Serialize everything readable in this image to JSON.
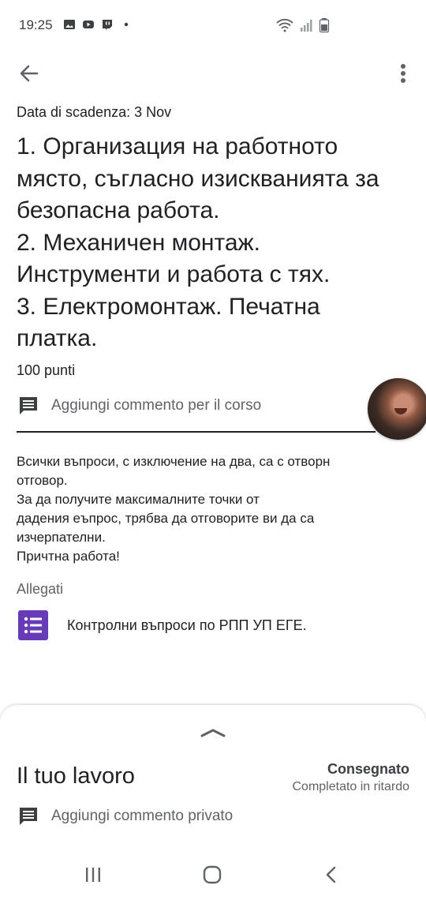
{
  "status_bar": {
    "time": "19:25",
    "icons_left": [
      "image-icon",
      "youtube-icon",
      "twitch-icon",
      "dot-icon"
    ],
    "icons_right": [
      "wifi-icon",
      "signal-icon",
      "battery-icon"
    ]
  },
  "toolbar": {
    "back_icon": "arrow-back-icon",
    "more_icon": "more-vert-icon"
  },
  "assignment": {
    "due_date": "Data di scadenza: 3 Nov",
    "title_lines": [
      "1. Организация на работното",
      "място, съгласно изискванията за",
      "безопасна работа.",
      "2. Механичен монтаж.",
      "Инструменти и работа с тях.",
      "3. Електромонтаж. Печатна",
      "платка."
    ],
    "points": "100 punti",
    "class_comment_placeholder": "Aggiungi commento per il corso",
    "description_lines": [
      "Всички въпроси, с изключение на два, са с отворн",
      "отговор.",
      "За да получите максималните точки от",
      "дадения еъпрос, трябва да отговорите ви да са",
      "изчерпателни.",
      "Причтна работа!"
    ],
    "attachments_label": "Allegati",
    "attachments": [
      {
        "title": "Контролни въпроси по РПП УП ЕГЕ.",
        "icon": "google-forms-icon",
        "color": "#673ab7"
      }
    ]
  },
  "your_work": {
    "title": "Il tuo lavoro",
    "status": "Consegnato",
    "substatus": "Completato in ritardo",
    "private_comment_placeholder": "Aggiungi commento privato"
  },
  "nav_bar": {
    "icons": [
      "recent-apps-icon",
      "home-icon",
      "back-icon"
    ]
  },
  "colors": {
    "text_primary": "#202124",
    "text_secondary": "#5f6368",
    "forms_purple": "#673ab7"
  }
}
